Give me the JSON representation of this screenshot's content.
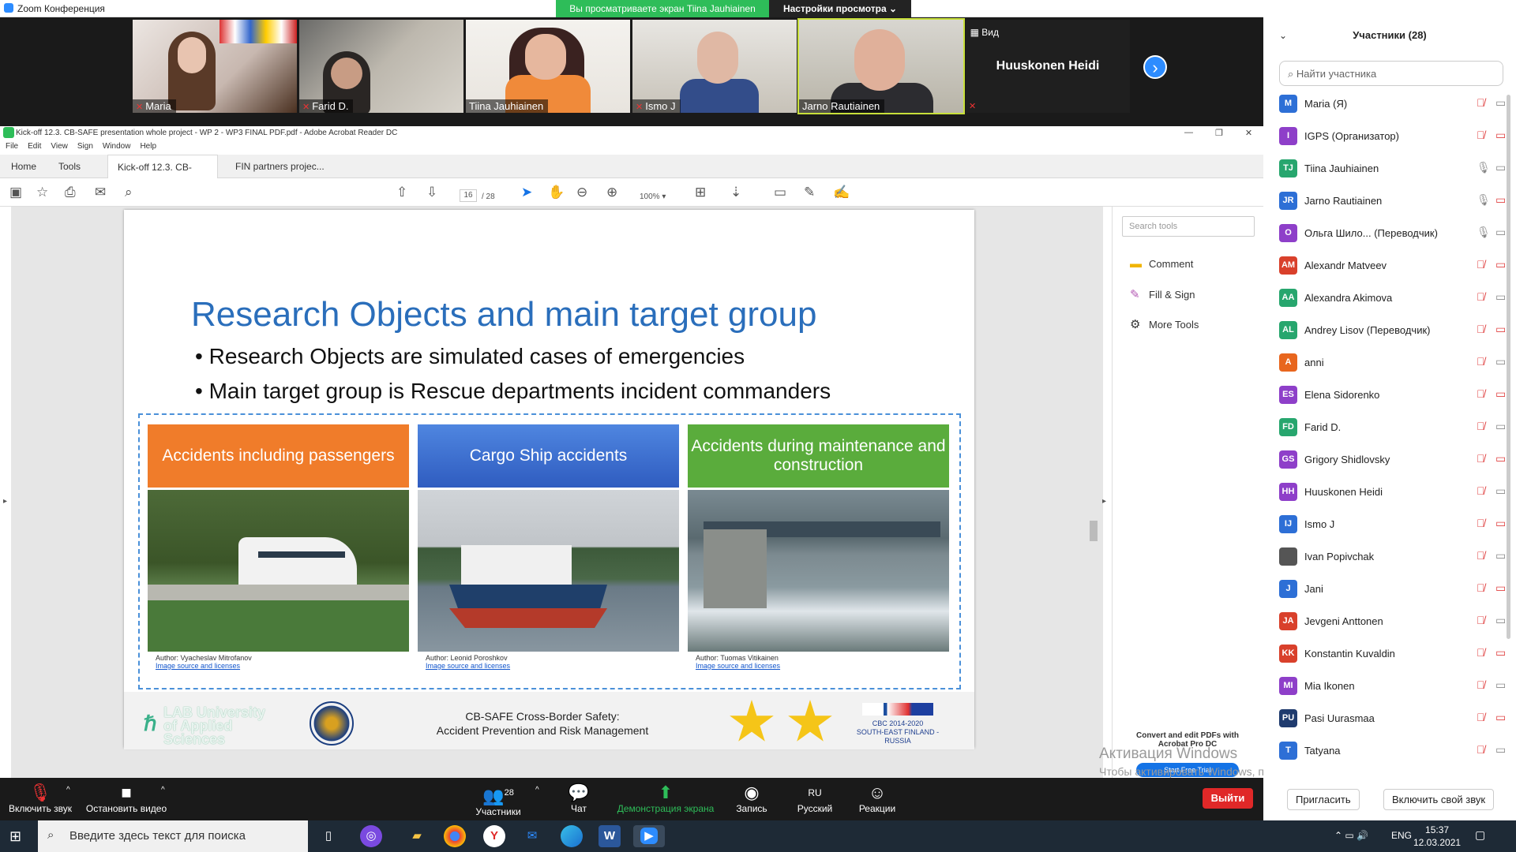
{
  "window": {
    "title": "Zoom Конференция"
  },
  "sharing": {
    "status": "Вы просматриваете экран Tiina Jauhiainen",
    "view_options": "Настройки просмотра"
  },
  "gallery": {
    "view_label": "Вид",
    "tiles": [
      {
        "name": "Maria",
        "muted": true
      },
      {
        "name": "Farid D.",
        "muted": true
      },
      {
        "name": "Tiina Jauhiainen",
        "muted": false
      },
      {
        "name": "Ismo J",
        "muted": true
      },
      {
        "name": "Jarno Rautiainen",
        "muted": false
      }
    ],
    "name_only_tile": "Huuskonen Heidi"
  },
  "acrobat": {
    "title": "Kick-off 12.3. CB-SAFE presentation whole project - WP 2 - WP3 FINAL PDF.pdf - Adobe Acrobat Reader DC",
    "menu": [
      "File",
      "Edit",
      "View",
      "Sign",
      "Window",
      "Help"
    ],
    "tabs": [
      "Home",
      "Tools",
      "Kick-off 12.3. CB-S...",
      "FIN partners projec..."
    ],
    "page_current": "16",
    "page_total": "/  28",
    "zoom": "100%",
    "right_panel": {
      "search_placeholder": "Search tools",
      "tools": [
        "Comment",
        "Fill & Sign",
        "More Tools"
      ],
      "convert_text": "Convert and edit PDFs with Acrobat Pro DC",
      "trial_button": "Start Free Trial"
    }
  },
  "slide": {
    "title": "Research Objects and main target group",
    "bullets": [
      "Research Objects are simulated cases of emergencies",
      "Main target group is Rescue departments incident commanders"
    ],
    "categories": [
      {
        "label": "Accidents including passengers",
        "color": "#f07c2a",
        "author": "Author: Vyacheslav Mitrofanov",
        "link": "Image source and licenses"
      },
      {
        "label": "Cargo Ship accidents",
        "color": "#3a6fd0",
        "author": "Author: Leonid Poroshkov",
        "link": "Image source and licenses"
      },
      {
        "label": "Accidents during maintenance and construction",
        "color": "#5aac3c",
        "author": "Author: Tuomas Vitikainen",
        "link": "Image source and licenses"
      }
    ],
    "footer": {
      "lab_logo": "LAB University of Applied Sciences",
      "project_line1": "CB-SAFE Cross-Border Safety:",
      "project_line2": "Accident Prevention and Risk Management",
      "cbc_line1": "CBC 2014-2020",
      "cbc_line2": "SOUTH-EAST FINLAND - RUSSIA"
    }
  },
  "watermark": {
    "line1": "Активация Windows",
    "line2": "Чтобы активировать Windows, перейдите в раздел \"Параметры\"."
  },
  "participants": {
    "header": "Участники (28)",
    "search_placeholder": "Найти участника",
    "list": [
      {
        "initials": "M",
        "name": "Maria (Я)",
        "color": "#2d6fd6",
        "mic": "muted",
        "video": "off"
      },
      {
        "initials": "I",
        "name": "IGPS (Организатор)",
        "color": "#8e3fc9",
        "mic": "muted",
        "video": "off"
      },
      {
        "initials": "TJ",
        "name": "Tiina Jauhiainen",
        "color": "#27a66e",
        "mic": "on",
        "video": "off"
      },
      {
        "initials": "JR",
        "name": "Jarno Rautiainen",
        "color": "#2d6fd6",
        "mic": "on",
        "video": "off"
      },
      {
        "initials": "O",
        "name": "Ольга Шило... (Переводчик)",
        "color": "#8e3fc9",
        "mic": "on",
        "video": "off"
      },
      {
        "initials": "AM",
        "name": "Alexandr Matveev",
        "color": "#d9402b",
        "mic": "muted",
        "video": "off"
      },
      {
        "initials": "AA",
        "name": "Alexandra Akimova",
        "color": "#27a66e",
        "mic": "muted",
        "video": "off"
      },
      {
        "initials": "AL",
        "name": "Andrey Lisov (Переводчик)",
        "color": "#27a66e",
        "mic": "muted",
        "video": "off"
      },
      {
        "initials": "A",
        "name": "anni",
        "color": "#e8661e",
        "mic": "muted",
        "video": "off"
      },
      {
        "initials": "ES",
        "name": "Elena Sidorenko",
        "color": "#8e3fc9",
        "mic": "muted",
        "video": "off"
      },
      {
        "initials": "FD",
        "name": "Farid D.",
        "color": "#27a66e",
        "mic": "muted",
        "video": "off"
      },
      {
        "initials": "GS",
        "name": "Grigory Shidlovsky",
        "color": "#8e3fc9",
        "mic": "muted",
        "video": "off"
      },
      {
        "initials": "HH",
        "name": "Huuskonen Heidi",
        "color": "#8e3fc9",
        "mic": "muted",
        "video": "off"
      },
      {
        "initials": "IJ",
        "name": "Ismo J",
        "color": "#2d6fd6",
        "mic": "muted",
        "video": "off"
      },
      {
        "initials": "",
        "name": "Ivan Popivchak",
        "color": "#555555",
        "mic": "muted",
        "video": "off"
      },
      {
        "initials": "J",
        "name": "Jani",
        "color": "#2d6fd6",
        "mic": "muted",
        "video": "off"
      },
      {
        "initials": "JA",
        "name": "Jevgeni Anttonen",
        "color": "#d9402b",
        "mic": "muted",
        "video": "off"
      },
      {
        "initials": "KK",
        "name": "Konstantin Kuvaldin",
        "color": "#d9402b",
        "mic": "muted",
        "video": "off"
      },
      {
        "initials": "MI",
        "name": "Mia Ikonen",
        "color": "#8e3fc9",
        "mic": "muted",
        "video": "off"
      },
      {
        "initials": "PU",
        "name": "Pasi Uurasmaa",
        "color": "#1f3b6e",
        "mic": "muted",
        "video": "off"
      },
      {
        "initials": "T",
        "name": "Tatyana",
        "color": "#2d6fd6",
        "mic": "muted",
        "video": "off"
      }
    ],
    "invite": "Пригласить",
    "unmute_self": "Включить свой звук"
  },
  "controls": {
    "unmute": "Включить звук",
    "stop_video": "Остановить видео",
    "participants": "Участники",
    "participants_count": "28",
    "chat": "Чат",
    "share": "Демонстрация экрана",
    "record": "Запись",
    "language": "Русский",
    "reactions": "Реакции",
    "leave": "Выйти"
  },
  "taskbar": {
    "search_placeholder": "Введите здесь текст для поиска",
    "lang": "ENG",
    "time": "15:37",
    "date": "12.03.2021"
  }
}
